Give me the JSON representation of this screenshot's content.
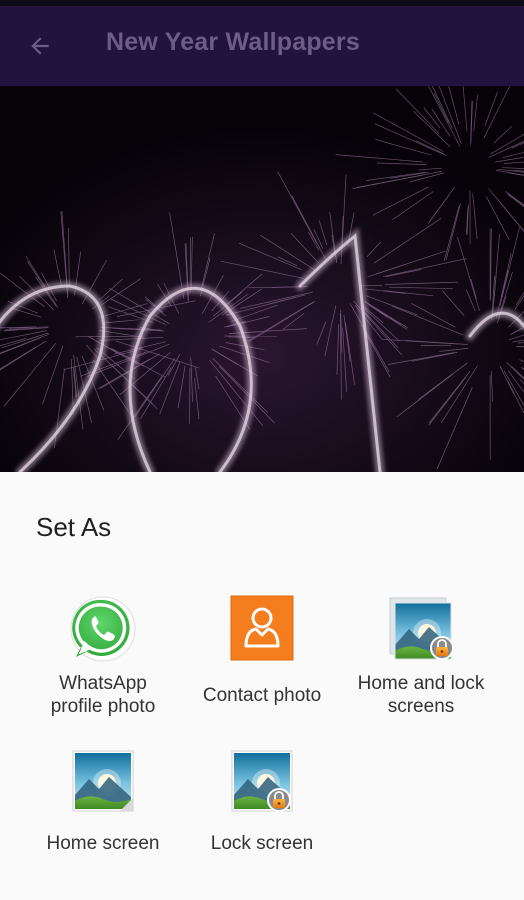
{
  "app_bar": {
    "title": "New Year Wallpapers",
    "back_icon": "arrow-back-icon",
    "background": "#22123e"
  },
  "wallpaper": {
    "description_icon": "sparkler-2017-wallpaper-image"
  },
  "set_as_sheet": {
    "title": "Set As",
    "options": [
      {
        "label": "WhatsApp profile photo",
        "line1": "WhatsApp",
        "line2": "profile photo",
        "icon": "whatsapp-icon"
      },
      {
        "label": "Contact photo",
        "icon": "contact-icon"
      },
      {
        "label": "Home and lock screens",
        "line1": "Home and lock",
        "line2": "screens",
        "icon": "home-lock-screens-icon"
      },
      {
        "label": "Home screen",
        "icon": "home-screen-icon"
      },
      {
        "label": "Lock screen",
        "icon": "lock-screen-icon"
      }
    ]
  },
  "colors": {
    "whatsapp_green": "#45c152",
    "contact_orange": "#f47d1e",
    "sheet_background": "#fafafa"
  }
}
